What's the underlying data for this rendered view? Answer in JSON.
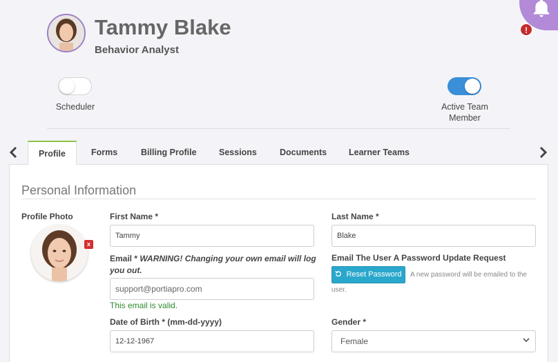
{
  "user": {
    "name": "Tammy Blake",
    "role": "Behavior Analyst"
  },
  "notifications": {
    "alert": "!"
  },
  "toggles": [
    {
      "label": "Scheduler",
      "on": false
    },
    {
      "label": "Active Team Member",
      "on": true
    }
  ],
  "tabs": [
    {
      "label": "Profile",
      "active": true
    },
    {
      "label": "Forms"
    },
    {
      "label": "Billing Profile"
    },
    {
      "label": "Sessions"
    },
    {
      "label": "Documents"
    },
    {
      "label": "Learner Teams"
    }
  ],
  "tab_nav": {
    "prev_icon": "chevron-left-icon",
    "next_icon": "chevron-right-icon",
    "prev": "‹",
    "next": "›"
  },
  "personal_info": {
    "title": "Personal Information",
    "profile_photo_label": "Profile Photo",
    "remove_photo": "x",
    "first_name_label": "First Name *",
    "first_name": "Tammy",
    "last_name_label": "Last Name *",
    "last_name": "Blake",
    "email_label": "Email *",
    "email_warning": "WARNING! Changing your own email will log",
    "email_warning_2": "you out.",
    "email_placeholder": "support@portiapro.com",
    "email_valid": "This email is valid.",
    "password_label": "Email The User A Password Update Request",
    "reset_button": "Reset Password",
    "reset_note_1": "A new password will be emailed to the",
    "reset_note_2": "user.",
    "dob_label": "Date of Birth * (mm-dd-yyyy)",
    "dob": "12-12-1967",
    "gender_label": "Gender *",
    "gender": "Female"
  },
  "colors": {
    "accent": "#b28ad8",
    "toggle_on": "#3a8fd8",
    "tab_active": "#8bc34a",
    "reset_button": "#2aa7cc",
    "valid": "#2e8b2e",
    "alert": "#c42b2b"
  }
}
